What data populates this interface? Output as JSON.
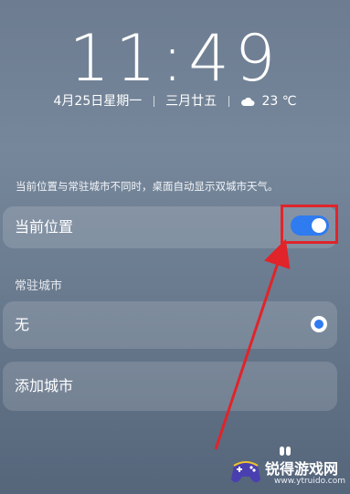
{
  "lockscreen": {
    "time": "11:49",
    "date": "4月25日星期一",
    "lunar_date": "三月廿五",
    "weather_icon": "cloud-icon",
    "temperature": "23 ℃"
  },
  "settings": {
    "info_text": "当前位置与常驻城市不同时，桌面自动显示双城市天气。",
    "current_location": {
      "label": "当前位置",
      "toggle_on": true
    },
    "resident_section_label": "常驻城市",
    "resident_none": {
      "label": "无",
      "selected": true
    },
    "add_city_label": "添加城市"
  },
  "watermark": {
    "title": "锐得游戏网",
    "url": "www.ytruido.com"
  },
  "colors": {
    "accent": "#2f7bf0",
    "annotation": "#e0242a"
  }
}
